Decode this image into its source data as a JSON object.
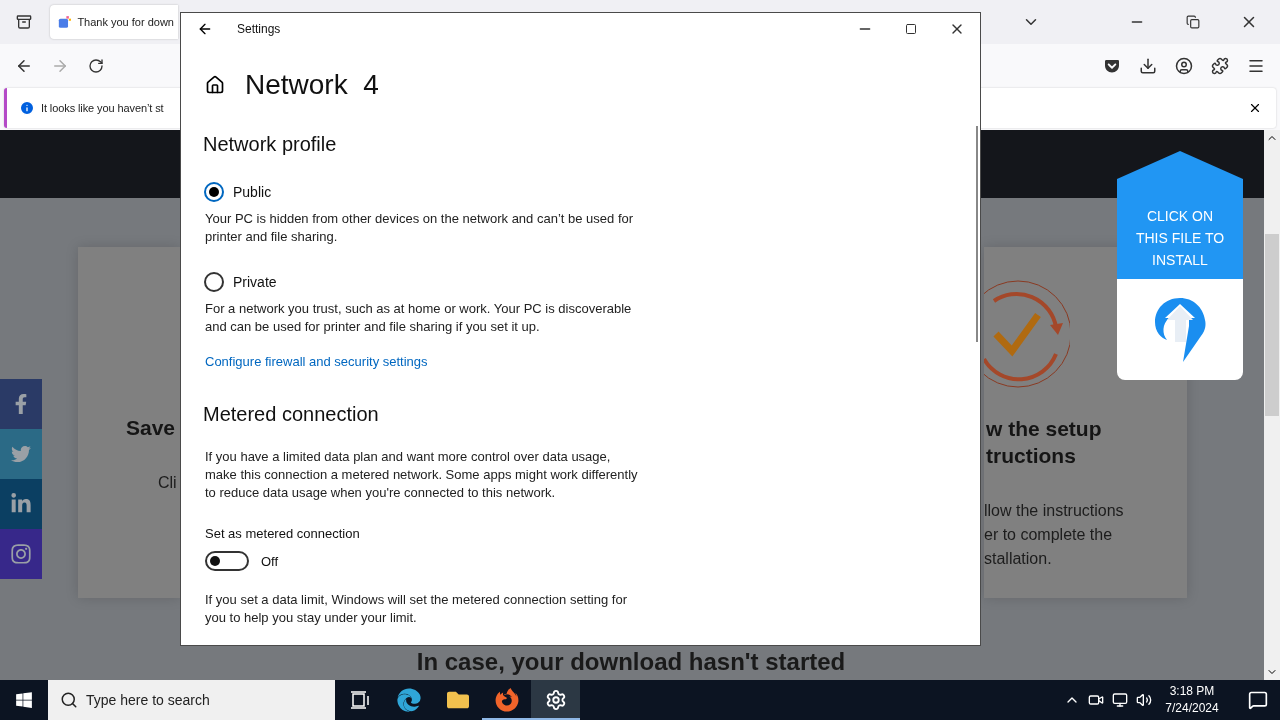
{
  "browser": {
    "tabs": [
      {
        "title": "Thank you for down",
        "selected": true
      }
    ],
    "notification": {
      "text": "It looks like you haven’t st"
    },
    "page": {
      "left_card": {
        "title": "Save",
        "text": "Cli"
      },
      "right_card": {
        "title_lines": [
          "w the setup",
          "tructions"
        ],
        "text_lines": [
          "llow the instructions",
          "er to complete the",
          "stallation."
        ]
      },
      "install_badge": {
        "lines": [
          "CLICK ON",
          "THIS FILE TO",
          "INSTALL"
        ]
      },
      "social_links": [
        {
          "kind": "facebook"
        },
        {
          "kind": "twitter"
        },
        {
          "kind": "linkedin"
        },
        {
          "kind": "instagram"
        }
      ],
      "footer_heading": "In case, your download hasn't started"
    }
  },
  "settings": {
    "title": "Settings",
    "page_title": "Network  4",
    "profile": {
      "heading": "Network profile",
      "options": [
        {
          "label": "Public",
          "description": "Your PC is hidden from other devices on the network and can’t be used for printer and file sharing.",
          "selected": true
        },
        {
          "label": "Private",
          "description": "For a network you trust, such as at home or work. Your PC is discoverable and can be used for printer and file sharing if you set it up.",
          "selected": false
        }
      ],
      "link": "Configure firewall and security settings"
    },
    "metered": {
      "heading": "Metered connection",
      "description": "If you have a limited data plan and want more control over data usage, make this connection a metered network. Some apps might work differently to reduce data usage when you're connected to this network.",
      "toggle": {
        "label": "Set as metered connection",
        "on": false,
        "state_text": "Off"
      },
      "note": "If you set a data limit, Windows will set the metered connection setting for you to help you stay under your limit."
    }
  },
  "taskbar": {
    "search": {
      "placeholder": "Type here to search"
    },
    "apps": [
      {
        "kind": "task-view",
        "running": false,
        "selected": false
      },
      {
        "kind": "edge",
        "running": false,
        "selected": false
      },
      {
        "kind": "explorer",
        "running": false,
        "selected": false
      },
      {
        "kind": "firefox",
        "running": true,
        "selected": false
      },
      {
        "kind": "settings",
        "running": true,
        "selected": true
      }
    ],
    "clock": {
      "time": "3:18 PM",
      "date": "7/24/2024"
    }
  }
}
